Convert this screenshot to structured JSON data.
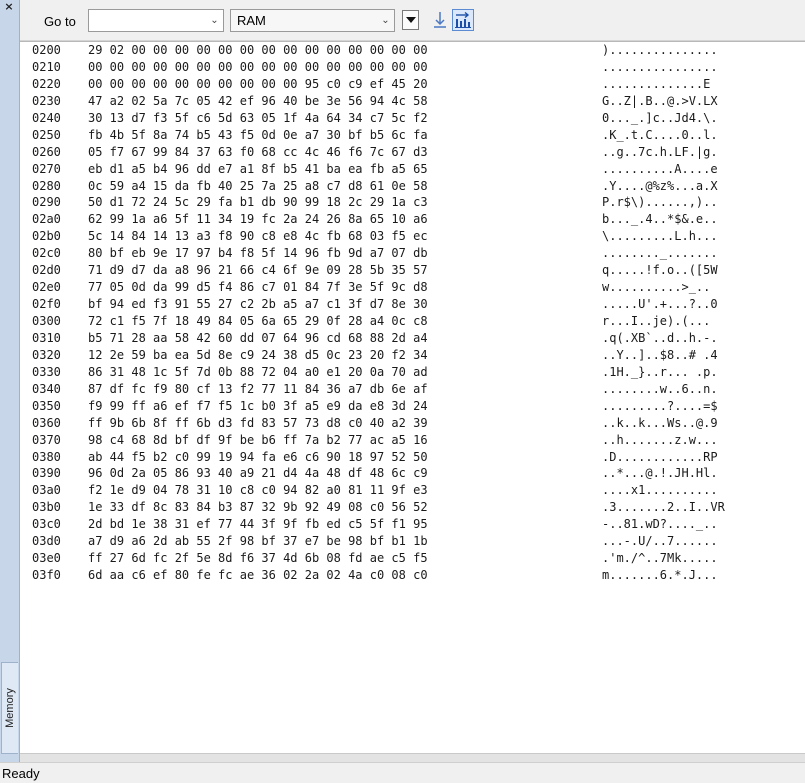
{
  "side_panel": {
    "close_glyph": "×",
    "tab_label": "Memory"
  },
  "toolbar": {
    "goto_label": "Go to",
    "goto_value": "",
    "view_value": "RAM",
    "icons": [
      "dropdown-icon",
      "step-icon",
      "columns-icon"
    ]
  },
  "memory": {
    "rows": [
      {
        "addr": "0200",
        "hex": "29 02 00 00 00 00 00 00 00 00 00 00 00 00 00 00",
        "ascii": ")..............."
      },
      {
        "addr": "0210",
        "hex": "00 00 00 00 00 00 00 00 00 00 00 00 00 00 00 00",
        "ascii": "................"
      },
      {
        "addr": "0220",
        "hex": "00 00 00 00 00 00 00 00 00 00 95 c0 c9 ef 45 20",
        "ascii": "..............E "
      },
      {
        "addr": "0230",
        "hex": "47 a2 02 5a 7c 05 42 ef 96 40 be 3e 56 94 4c 58",
        "ascii": "G..Z|.B..@.>V.LX"
      },
      {
        "addr": "0240",
        "hex": "30 13 d7 f3 5f c6 5d 63 05 1f 4a 64 34 c7 5c f2",
        "ascii": "0..._.]c..Jd4.\\."
      },
      {
        "addr": "0250",
        "hex": "fb 4b 5f 8a 74 b5 43 f5 0d 0e a7 30 bf b5 6c fa",
        "ascii": ".K_.t.C....0..l."
      },
      {
        "addr": "0260",
        "hex": "05 f7 67 99 84 37 63 f0 68 cc 4c 46 f6 7c 67 d3",
        "ascii": "..g..7c.h.LF.|g."
      },
      {
        "addr": "0270",
        "hex": "eb d1 a5 b4 96 dd e7 a1 8f b5 41 ba ea fb a5 65",
        "ascii": "..........A....e"
      },
      {
        "addr": "0280",
        "hex": "0c 59 a4 15 da fb 40 25 7a 25 a8 c7 d8 61 0e 58",
        "ascii": ".Y....@%z%...a.X"
      },
      {
        "addr": "0290",
        "hex": "50 d1 72 24 5c 29 fa b1 db 90 99 18 2c 29 1a c3",
        "ascii": "P.r$\\)......,).."
      },
      {
        "addr": "02a0",
        "hex": "62 99 1a a6 5f 11 34 19 fc 2a 24 26 8a 65 10 a6",
        "ascii": "b..._.4..*$&.e.."
      },
      {
        "addr": "02b0",
        "hex": "5c 14 84 14 13 a3 f8 90 c8 e8 4c fb 68 03 f5 ec",
        "ascii": "\\.........L.h..."
      },
      {
        "addr": "02c0",
        "hex": "80 bf eb 9e 17 97 b4 f8 5f 14 96 fb 9d a7 07 db",
        "ascii": "........_......."
      },
      {
        "addr": "02d0",
        "hex": "71 d9 d7 da a8 96 21 66 c4 6f 9e 09 28 5b 35 57",
        "ascii": "q.....!f.o..([5W"
      },
      {
        "addr": "02e0",
        "hex": "77 05 0d da 99 d5 f4 86 c7 01 84 7f 3e 5f 9c d8",
        "ascii": "w..........>_.."
      },
      {
        "addr": "02f0",
        "hex": "bf 94 ed f3 91 55 27 c2 2b a5 a7 c1 3f d7 8e 30",
        "ascii": ".....U'.+...?..0"
      },
      {
        "addr": "0300",
        "hex": "72 c1 f5 7f 18 49 84 05 6a 65 29 0f 28 a4 0c c8",
        "ascii": "r...I..je).(..."
      },
      {
        "addr": "0310",
        "hex": "b5 71 28 aa 58 42 60 dd 07 64 96 cd 68 88 2d a4",
        "ascii": ".q(.XB`..d..h.-."
      },
      {
        "addr": "0320",
        "hex": "12 2e 59 ba ea 5d 8e c9 24 38 d5 0c 23 20 f2 34",
        "ascii": "..Y..]..$8..# .4"
      },
      {
        "addr": "0330",
        "hex": "86 31 48 1c 5f 7d 0b 88 72 04 a0 e1 20 0a 70 ad",
        "ascii": ".1H._}..r... .p."
      },
      {
        "addr": "0340",
        "hex": "87 df fc f9 80 cf 13 f2 77 11 84 36 a7 db 6e af",
        "ascii": "........w..6..n."
      },
      {
        "addr": "0350",
        "hex": "f9 99 ff a6 ef f7 f5 1c b0 3f a5 e9 da e8 3d 24",
        "ascii": ".........?....=$"
      },
      {
        "addr": "0360",
        "hex": "ff 9b 6b 8f ff 6b d3 fd 83 57 73 d8 c0 40 a2 39",
        "ascii": "..k..k...Ws..@.9"
      },
      {
        "addr": "0370",
        "hex": "98 c4 68 8d bf df 9f be b6 ff 7a b2 77 ac a5 16",
        "ascii": "..h.......z.w..."
      },
      {
        "addr": "0380",
        "hex": "ab 44 f5 b2 c0 99 19 94 fa e6 c6 90 18 97 52 50",
        "ascii": ".D............RP"
      },
      {
        "addr": "0390",
        "hex": "96 0d 2a 05 86 93 40 a9 21 d4 4a 48 df 48 6c c9",
        "ascii": "..*...@.!.JH.Hl."
      },
      {
        "addr": "03a0",
        "hex": "f2 1e d9 04 78 31 10 c8 c0 94 82 a0 81 11 9f e3",
        "ascii": "....x1.........."
      },
      {
        "addr": "03b0",
        "hex": "1e 33 df 8c 83 84 b3 87 32 9b 92 49 08 c0 56 52",
        "ascii": ".3.......2..I..VR"
      },
      {
        "addr": "03c0",
        "hex": "2d bd 1e 38 31 ef 77 44 3f 9f fb ed c5 5f f1 95",
        "ascii": "-..81.wD?...._.."
      },
      {
        "addr": "03d0",
        "hex": "a7 d9 a6 2d ab 55 2f 98 bf 37 e7 be 98 bf b1 1b",
        "ascii": "...-.U/..7......"
      },
      {
        "addr": "03e0",
        "hex": "ff 27 6d fc 2f 5e 8d f6 37 4d 6b 08 fd ae c5 f5",
        "ascii": ".'m./^..7Mk....."
      },
      {
        "addr": "03f0",
        "hex": "6d aa c6 ef 80 fe fc ae 36 02 2a 02 4a c0 08 c0",
        "ascii": "m.......6.*.J..."
      }
    ]
  },
  "status": {
    "text": "Ready"
  }
}
